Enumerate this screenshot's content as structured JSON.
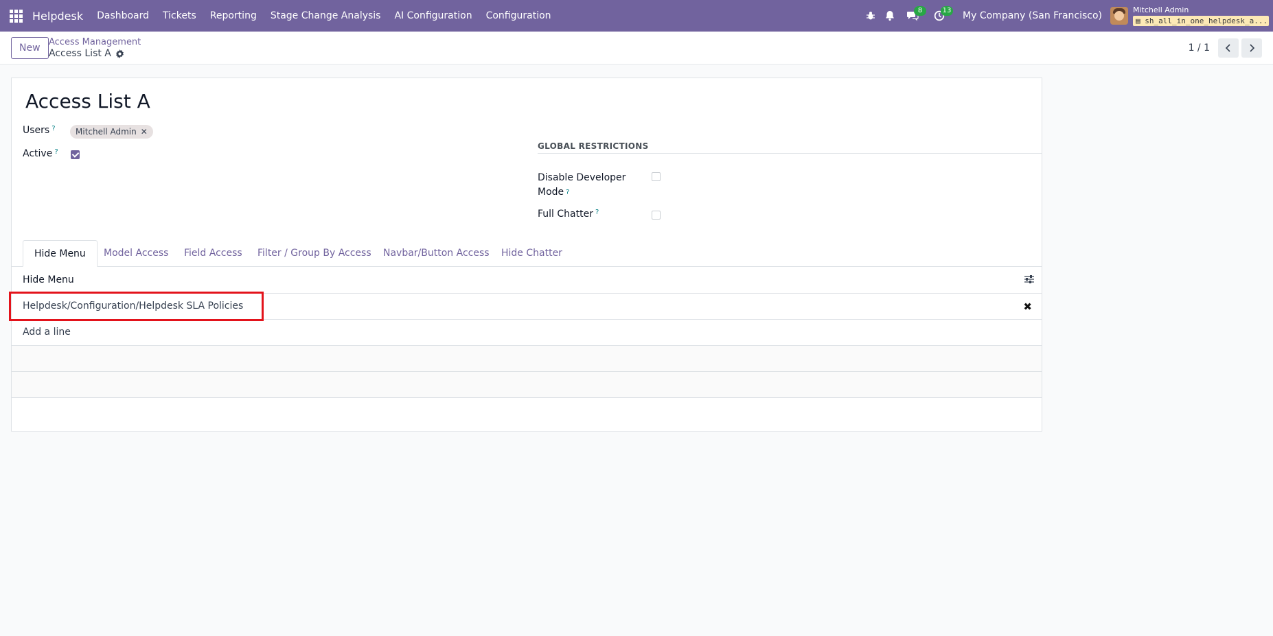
{
  "navbar": {
    "brand": "Helpdesk",
    "menu": [
      "Dashboard",
      "Tickets",
      "Reporting",
      "Stage Change Analysis",
      "AI Configuration",
      "Configuration"
    ],
    "messages_count": "8",
    "activities_count": "13",
    "company": "My Company (San Francisco)",
    "user_name": "Mitchell Admin",
    "database": "sh_all_in_one_helpdesk_a..."
  },
  "control": {
    "new_label": "New",
    "breadcrumb_parent": "Access Management",
    "breadcrumb_current": "Access List A",
    "pager": "1 / 1"
  },
  "form": {
    "title": "Access List A",
    "users_label": "Users",
    "users_tag": "Mitchell Admin",
    "active_label": "Active",
    "active_checked": true,
    "help_mark": "?",
    "global_restrictions": "GLOBAL RESTRICTIONS",
    "disable_dev_line1": "Disable Developer",
    "disable_dev_line2": "Mode",
    "full_chatter": "Full Chatter",
    "tabs": [
      "Hide Menu",
      "Model Access",
      "Field Access",
      "Filter / Group By Access",
      "Navbar/Button Access",
      "Hide Chatter"
    ],
    "active_tab": "Hide Menu",
    "list_header": "Hide Menu",
    "rows": [
      "Helpdesk/Configuration/Helpdesk SLA Policies"
    ],
    "add_line": "Add a line"
  },
  "colors": {
    "brand": "#71639e",
    "highlight": "#e3131b",
    "badge": "#28a745"
  }
}
